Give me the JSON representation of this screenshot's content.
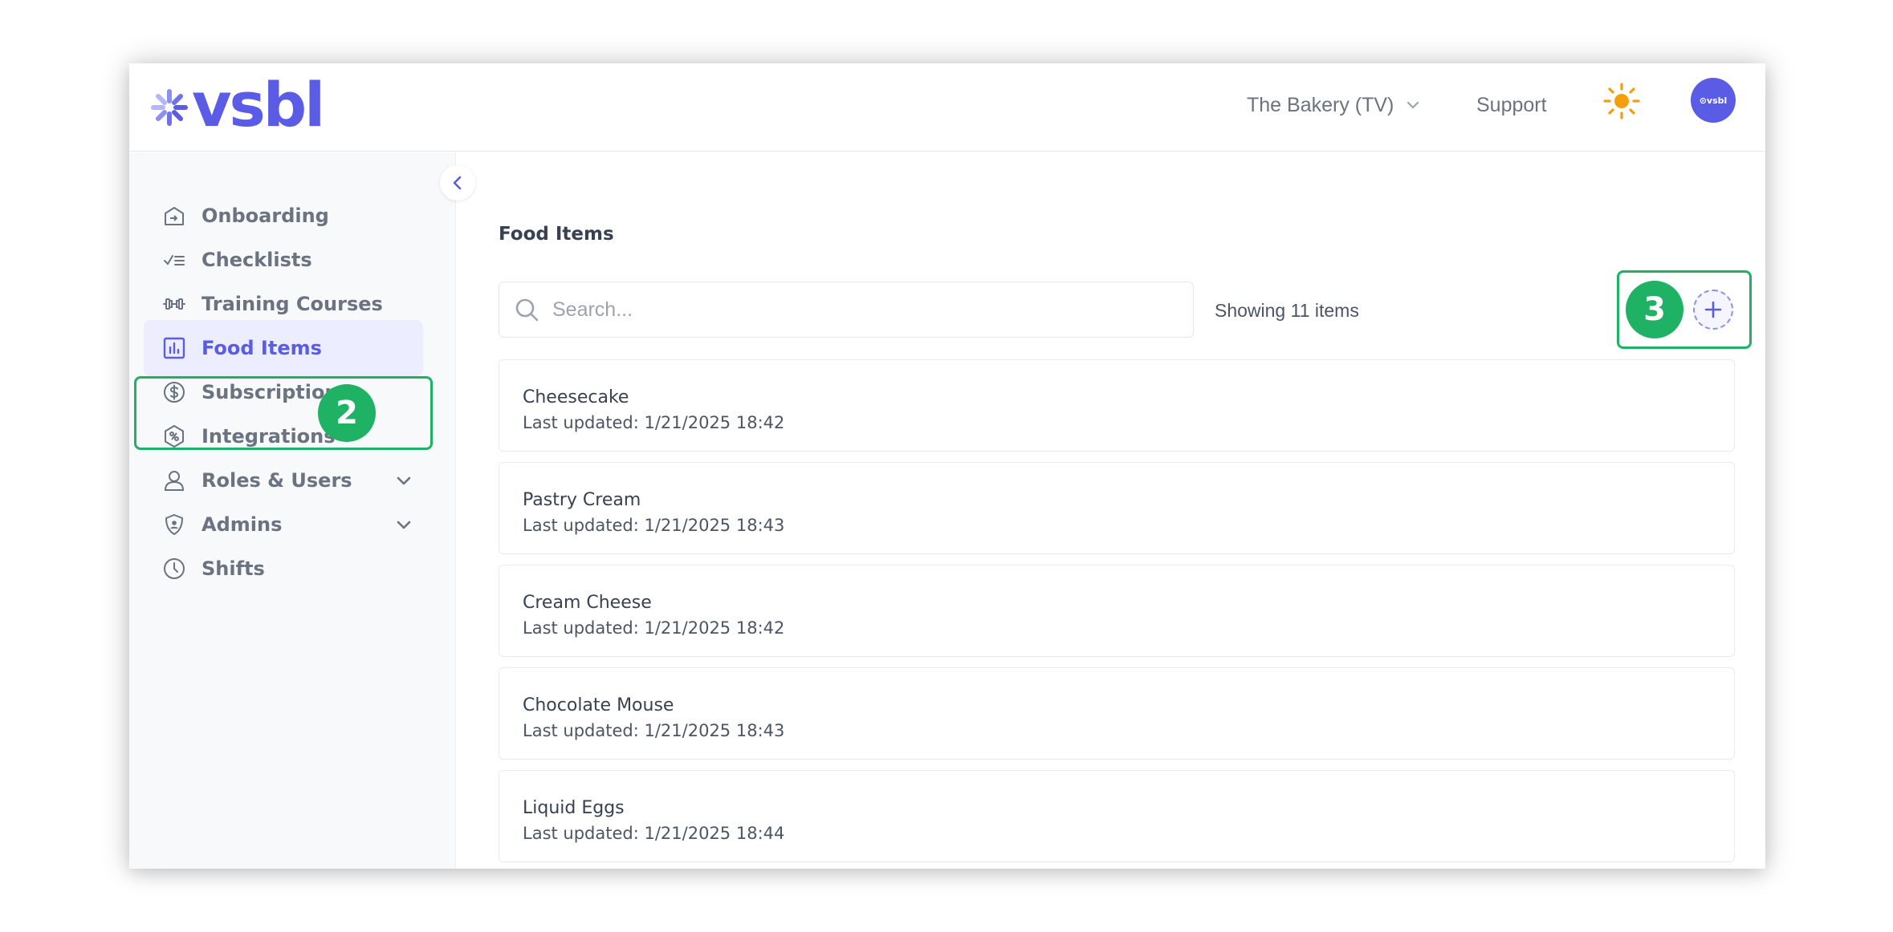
{
  "brand": {
    "name": "vsbl",
    "color": "#5a5ce6"
  },
  "header": {
    "org_selector": "The Bakery (TV)",
    "support_label": "Support",
    "avatar_text": "⊙vsbl"
  },
  "sidebar": {
    "items": [
      {
        "label": "Onboarding",
        "icon": "onboarding-icon",
        "active": false
      },
      {
        "label": "Checklists",
        "icon": "checklist-icon",
        "active": false
      },
      {
        "label": "Training Courses",
        "icon": "dumbbell-icon",
        "active": false
      },
      {
        "label": "Food Items",
        "icon": "chart-icon",
        "active": true
      },
      {
        "label": "Subscriptions",
        "icon": "dollar-icon",
        "active": false
      },
      {
        "label": "Integrations",
        "icon": "integrations-icon",
        "active": false
      },
      {
        "label": "Roles & Users",
        "icon": "user-icon",
        "active": false,
        "expandable": true
      },
      {
        "label": "Admins",
        "icon": "shield-icon",
        "active": false,
        "expandable": true
      },
      {
        "label": "Shifts",
        "icon": "clock-icon",
        "active": false
      }
    ]
  },
  "main": {
    "title": "Food Items",
    "search_placeholder": "Search...",
    "count_text": "Showing 11 items",
    "items": [
      {
        "name": "Cheesecake",
        "updated": "Last updated: 1/21/2025 18:42"
      },
      {
        "name": "Pastry Cream",
        "updated": "Last updated: 1/21/2025 18:43"
      },
      {
        "name": "Cream Cheese",
        "updated": "Last updated: 1/21/2025 18:42"
      },
      {
        "name": "Chocolate Mouse",
        "updated": "Last updated: 1/21/2025 18:43"
      },
      {
        "name": "Liquid Eggs",
        "updated": "Last updated: 1/21/2025 18:44"
      }
    ]
  },
  "annotations": {
    "step_food_items": "2",
    "step_add_button": "3",
    "color": "#1fb164"
  }
}
